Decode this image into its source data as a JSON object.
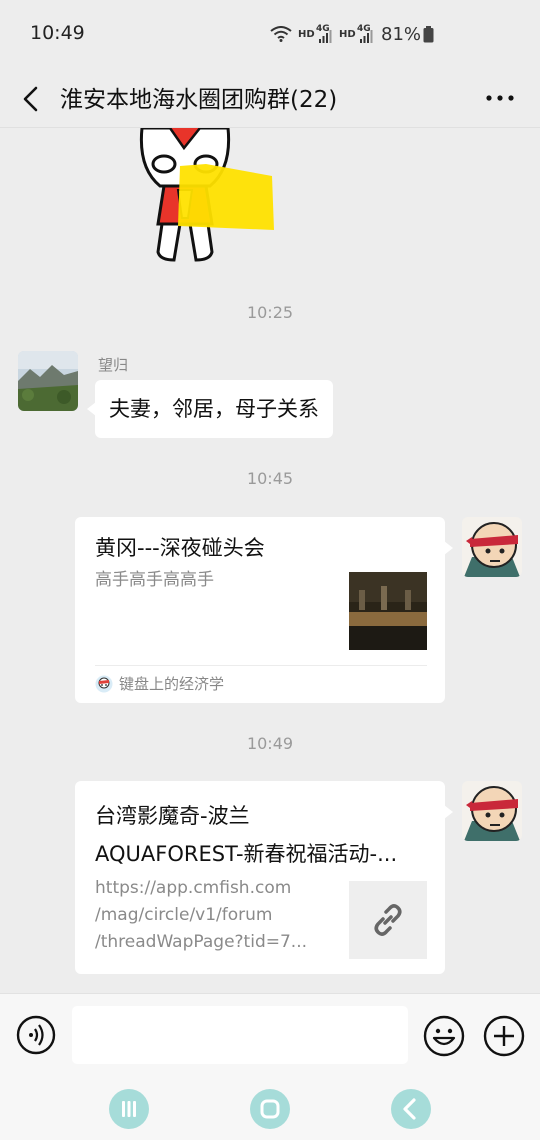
{
  "status_bar": {
    "time": "10:49",
    "network_labels": [
      "HD",
      "4G",
      "HD",
      "4G"
    ],
    "battery": "81%"
  },
  "header": {
    "title": "淮安本地海水圈团购群(22)"
  },
  "messages": [
    {
      "type": "sticker",
      "icon": "cartoon-hero-sticker"
    },
    {
      "type": "time",
      "text": "10:25"
    },
    {
      "type": "text",
      "side": "left",
      "sender": "望归",
      "text": "夫妻，邻居，母子关系"
    },
    {
      "type": "time",
      "text": "10:45"
    },
    {
      "type": "article_card",
      "side": "right",
      "title": "黄冈---深夜碰头会",
      "desc": "高手高手高高手",
      "source": "键盘上的经济学"
    },
    {
      "type": "time",
      "text": "10:49"
    },
    {
      "type": "link_card",
      "side": "right",
      "title_line1": "台湾影魔奇-波兰",
      "title_line2": "AQUAFOREST-新春祝福活动-...",
      "url_lines": [
        "https://app.cmfish.com",
        "/mag/circle/v1/forum",
        "/threadWapPage?tid=7..."
      ]
    }
  ],
  "input": {
    "placeholder": ""
  },
  "colors": {
    "background": "#ededed",
    "bubble": "#ffffff",
    "nav_button": "#a6dcd9"
  }
}
